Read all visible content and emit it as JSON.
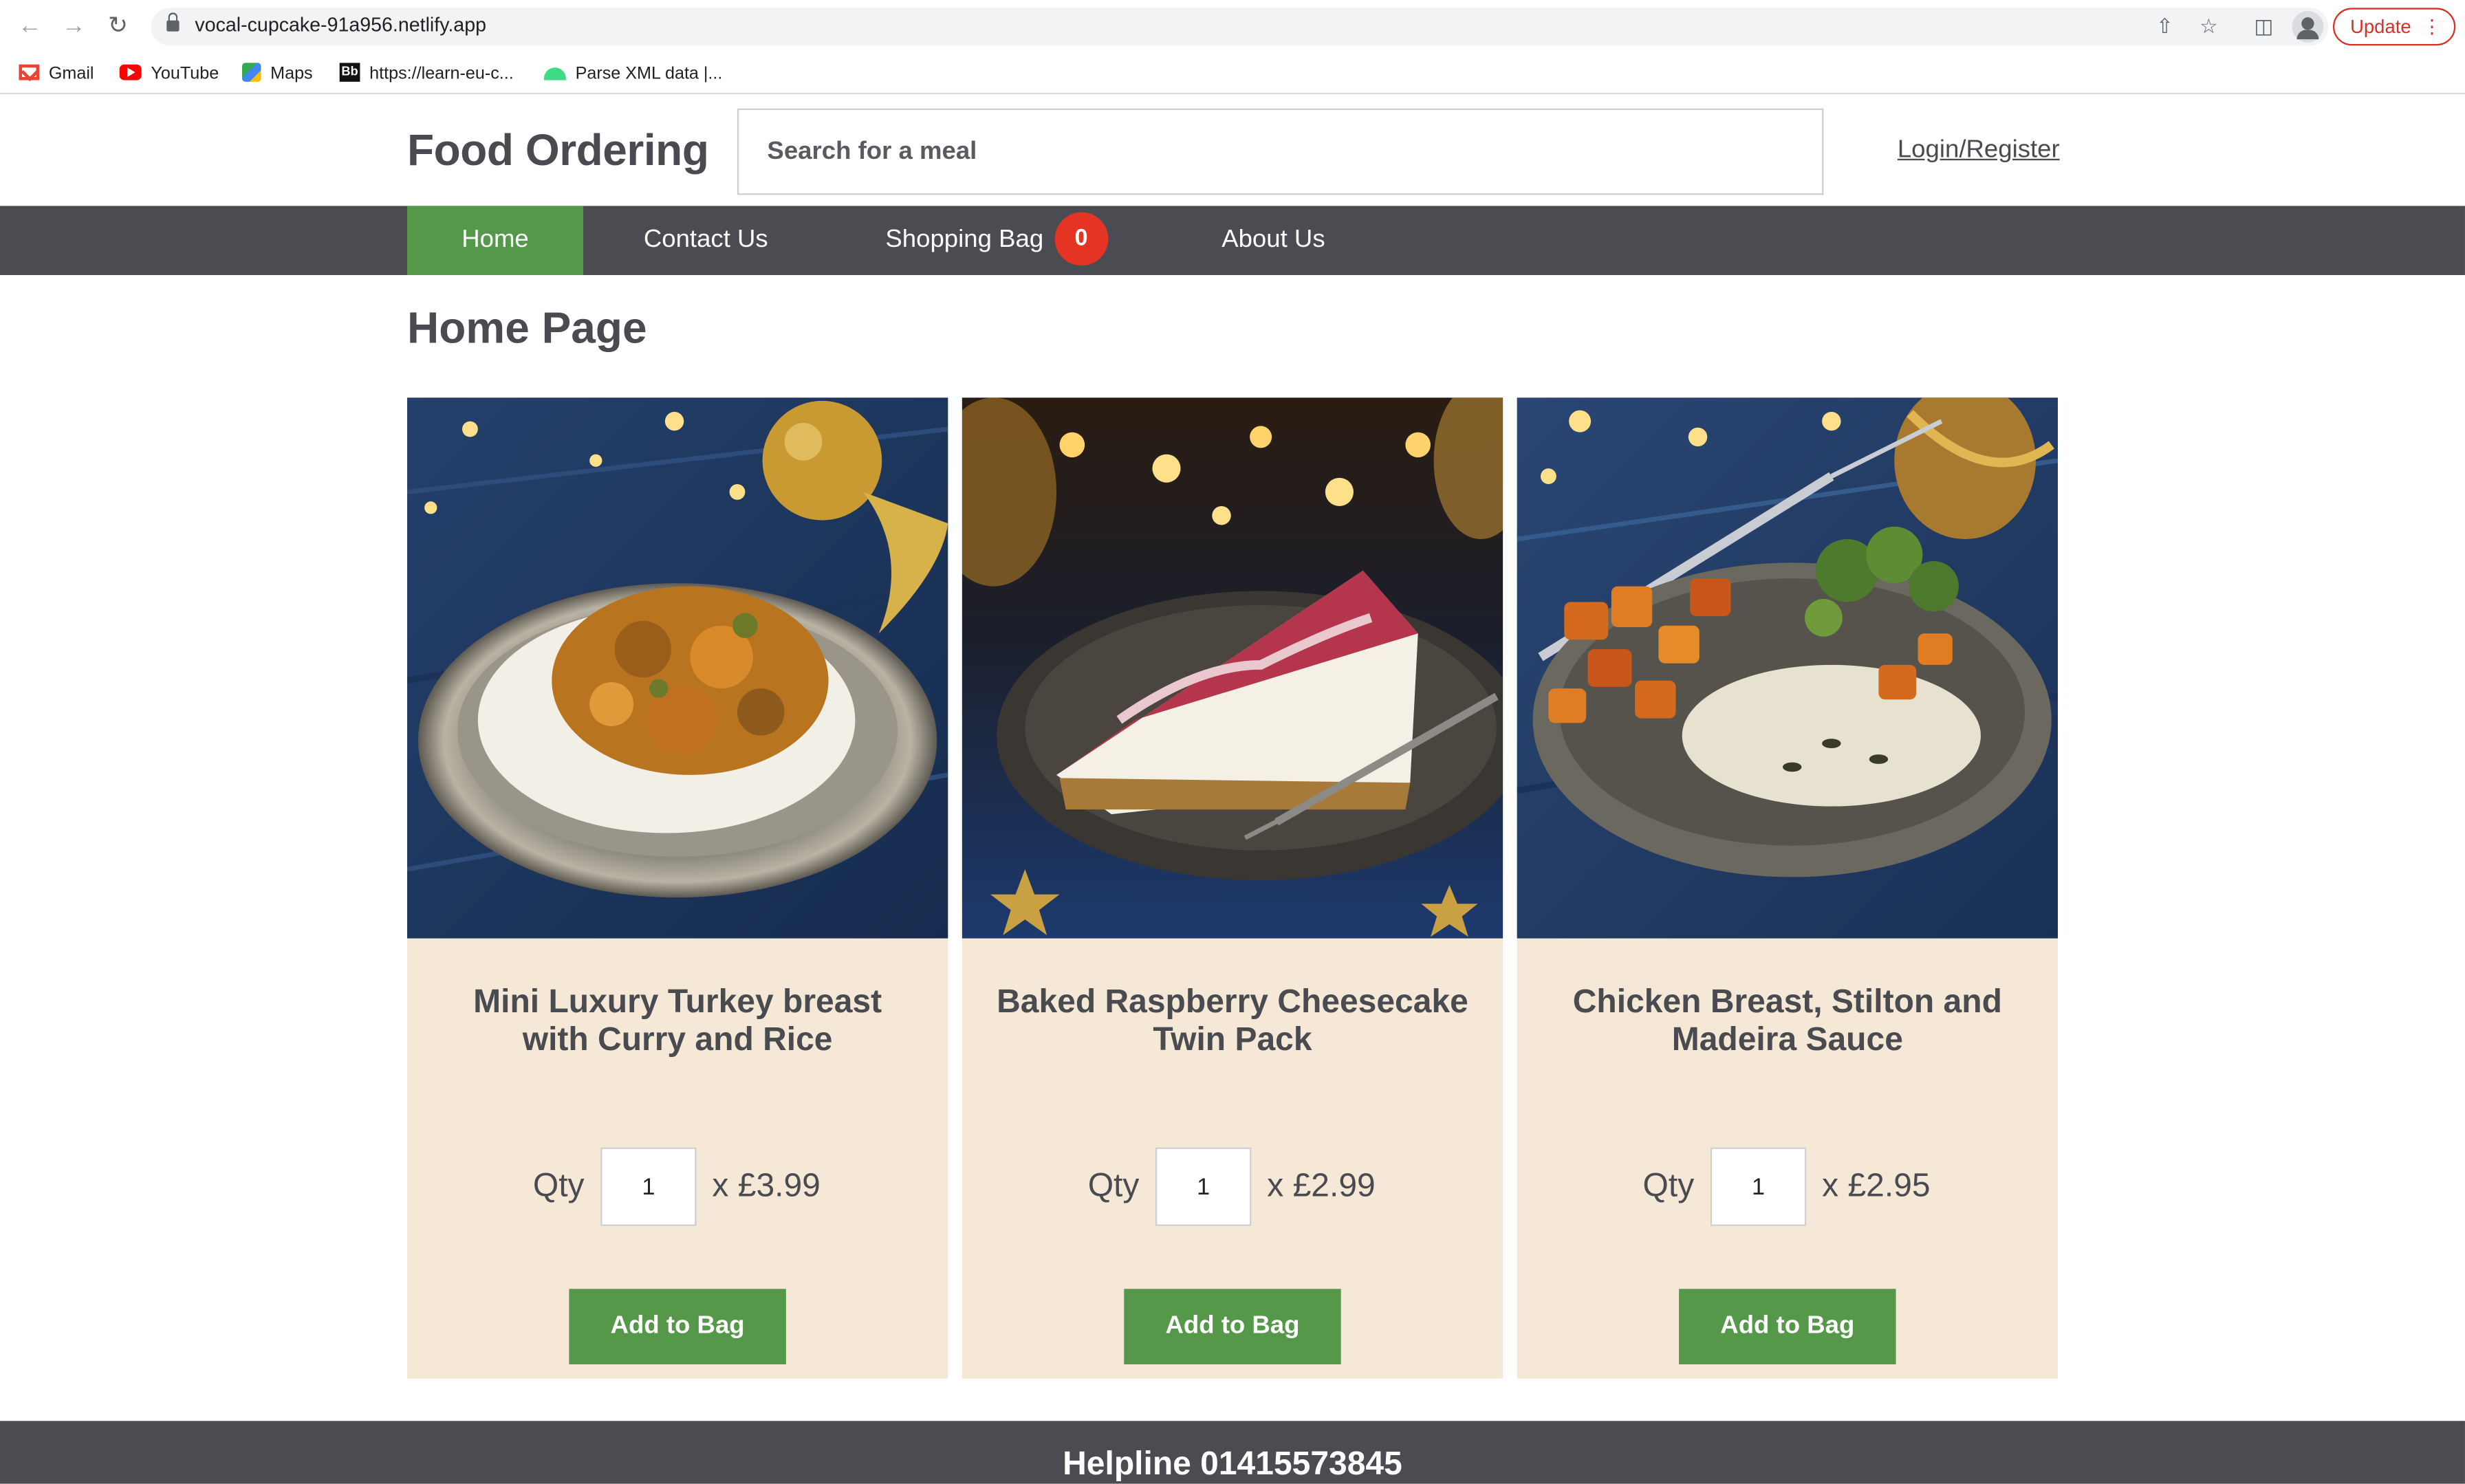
{
  "browser": {
    "url": "vocal-cupcake-91a956.netlify.app",
    "update_label": "Update",
    "bookmarks": [
      "Gmail",
      "YouTube",
      "Maps",
      "https://learn-eu-c...",
      "Parse XML data  |..."
    ]
  },
  "header": {
    "brand": "Food Ordering",
    "search_placeholder": "Search for a meal",
    "login_label": "Login/Register"
  },
  "nav": {
    "home": "Home",
    "contact": "Contact Us",
    "bag": "Shopping Bag",
    "bag_count": "0",
    "about": "About Us"
  },
  "page": {
    "title": "Home Page"
  },
  "products": [
    {
      "name": "Mini Luxury Turkey breast with Curry and Rice",
      "qty_label": "Qty",
      "qty": "1",
      "price": "x £3.99",
      "button": "Add to Bag"
    },
    {
      "name": "Baked Raspberry Cheesecake Twin Pack",
      "qty_label": "Qty",
      "qty": "1",
      "price": "x £2.99",
      "button": "Add to Bag"
    },
    {
      "name": "Chicken Breast, Stilton and Madeira Sauce",
      "qty_label": "Qty",
      "qty": "1",
      "price": "x £2.95",
      "button": "Add to Bag"
    }
  ],
  "footer": {
    "helpline": "Helpline 01415573845"
  },
  "colors": {
    "accent": "#56984a",
    "nav_bg": "#4b4c51",
    "badge": "#e53424",
    "card_bg": "#f5e8d7"
  }
}
